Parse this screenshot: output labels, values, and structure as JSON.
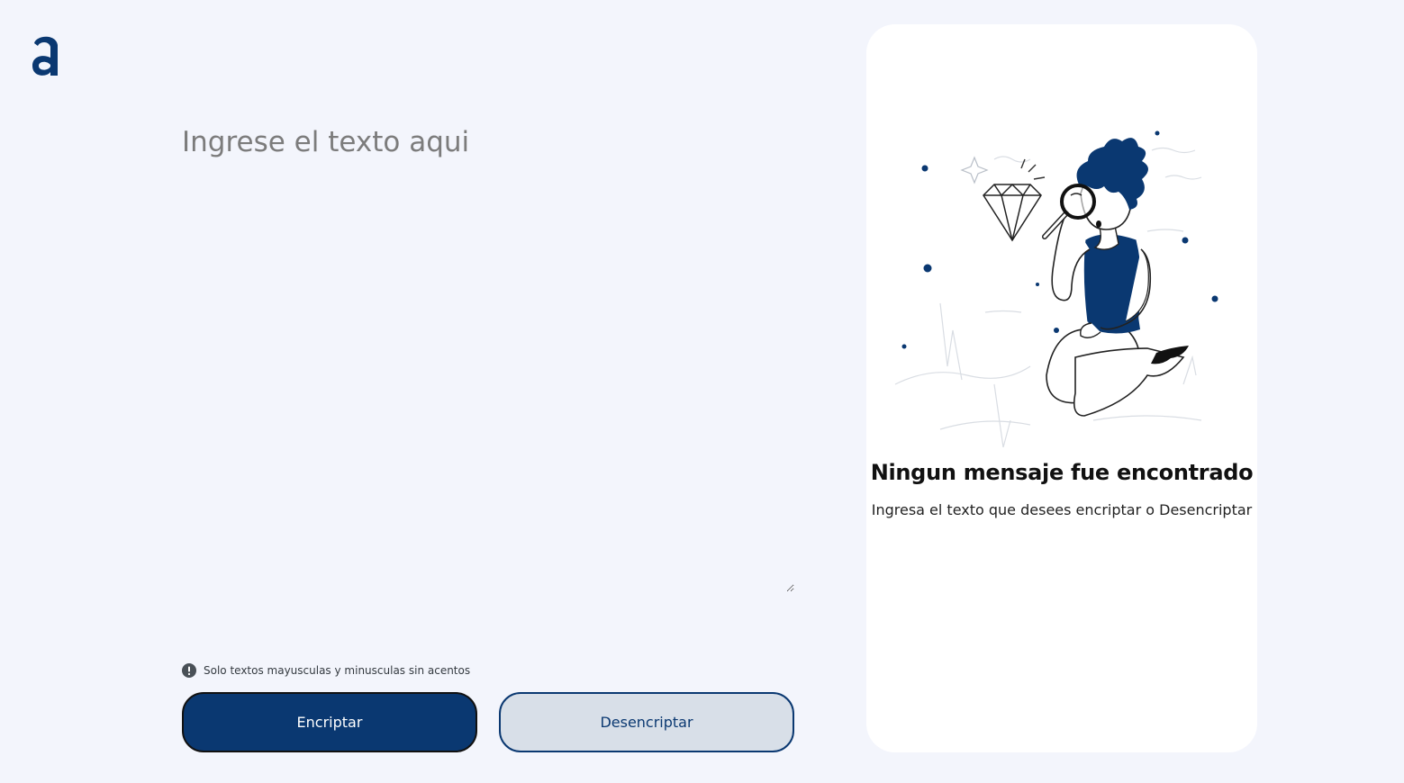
{
  "app": {
    "logo_icon": "alura-a-logo-icon",
    "accent_color": "#0a3871",
    "background_color": "#f3f5fc"
  },
  "input": {
    "placeholder": "Ingrese el texto aqui",
    "value": ""
  },
  "hint": {
    "icon": "exclamation-circle-icon",
    "text": "Solo textos mayusculas y minusculas sin acentos"
  },
  "buttons": {
    "encrypt_label": "Encriptar",
    "decrypt_label": "Desencriptar"
  },
  "output": {
    "illustration": "person-with-magnifying-glass-illustration",
    "title": "Ningun mensaje fue encontrado",
    "subtitle": "Ingresa el texto que desees encriptar o Desencriptar"
  }
}
